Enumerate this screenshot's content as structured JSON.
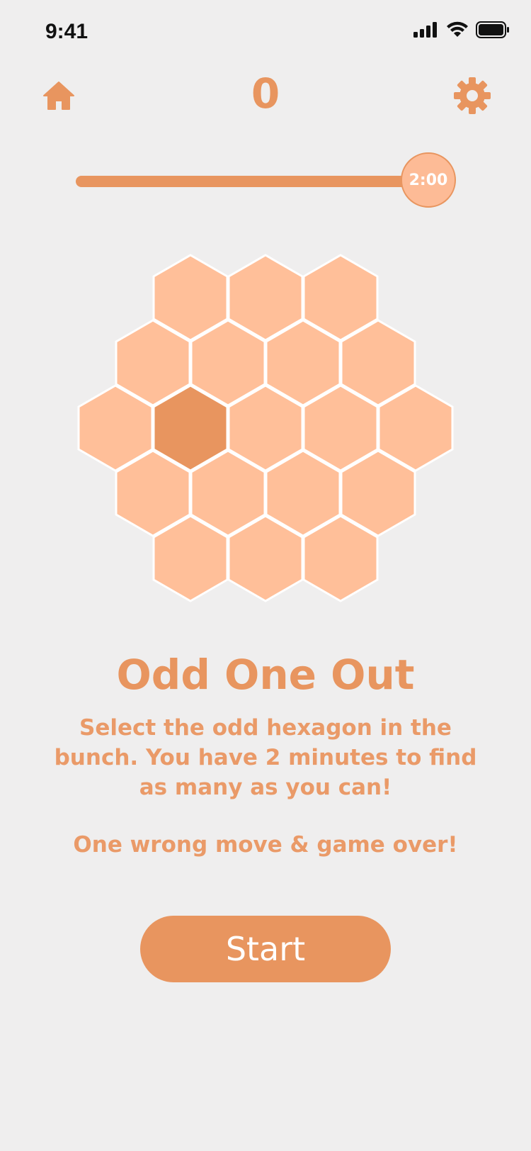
{
  "status_bar": {
    "time": "9:41"
  },
  "header": {
    "score": "0"
  },
  "timer": {
    "label": "2:00",
    "remaining_fraction": 1.0
  },
  "board": {
    "rows": [
      3,
      4,
      5,
      4,
      3
    ],
    "odd_cell": {
      "row": 2,
      "col": 1
    },
    "cell_color": "#ffbf99",
    "odd_color": "#e8955f"
  },
  "instructions": {
    "title": "Odd One Out",
    "description": "Select the odd hexagon in the bunch. You have 2 minutes to find as many as you can!",
    "warning": "One wrong move & game over!"
  },
  "start_button": {
    "label": "Start"
  },
  "colors": {
    "accent": "#e8955f",
    "background": "#efeeee"
  }
}
